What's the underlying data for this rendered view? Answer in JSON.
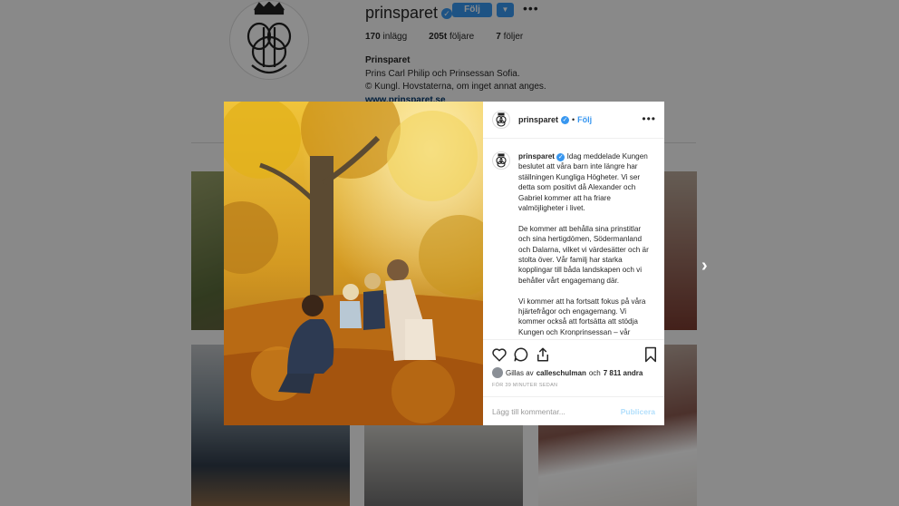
{
  "colors": {
    "accent": "#3897f0",
    "text": "#262626",
    "muted": "#999999"
  },
  "profile": {
    "username": "prinsparet",
    "follow_label": "Följ",
    "dropdown_icon": "caret-down-icon",
    "more_icon": "more-icon",
    "stats": {
      "posts_count": "170",
      "posts_label": "inlägg",
      "followers_count": "205t",
      "followers_label": "följare",
      "following_count": "7",
      "following_label": "följer"
    },
    "bio_name": "Prinsparet",
    "bio_line1": "Prins Carl Philip och Prinsessan Sofia.",
    "bio_line2": "© Kungl. Hovstaterna, om inget annat anges.",
    "bio_link": "www.prinsparet.se"
  },
  "post": {
    "username": "prinsparet",
    "separator": "•",
    "follow_label": "Följ",
    "caption_user": "prinsparet",
    "caption_p1": "Idag meddelade Kungen beslutet att våra barn inte längre har ställningen Kungliga Högheter. Vi ser detta som positivt då Alexander och Gabriel kommer att ha friare valmöjligheter i livet.",
    "caption_p2": "De kommer att behålla sina prinstitlar och sina hertigdömen, Södermanland och Dalarna, vilket vi värdesätter och är stolta över. Vår familj har starka kopplingar till båda landskapen och vi behåller vårt engagemang där.",
    "caption_p3": "Vi kommer att ha fortsatt fokus på våra hjärtefrågor och engagemang. Vi kommer också att fortsätta att stödja Kungen och Kronprinsessan – vår blivande statschef – och delta i",
    "likes_prefix": "Gillas av",
    "likes_user": "calleschulman",
    "likes_and": "och",
    "likes_count": "7 811 andra",
    "time": "FÖR 39 MINUTER SEDAN",
    "comment_placeholder": "Lägg till kommentar...",
    "publish_label": "Publicera"
  }
}
